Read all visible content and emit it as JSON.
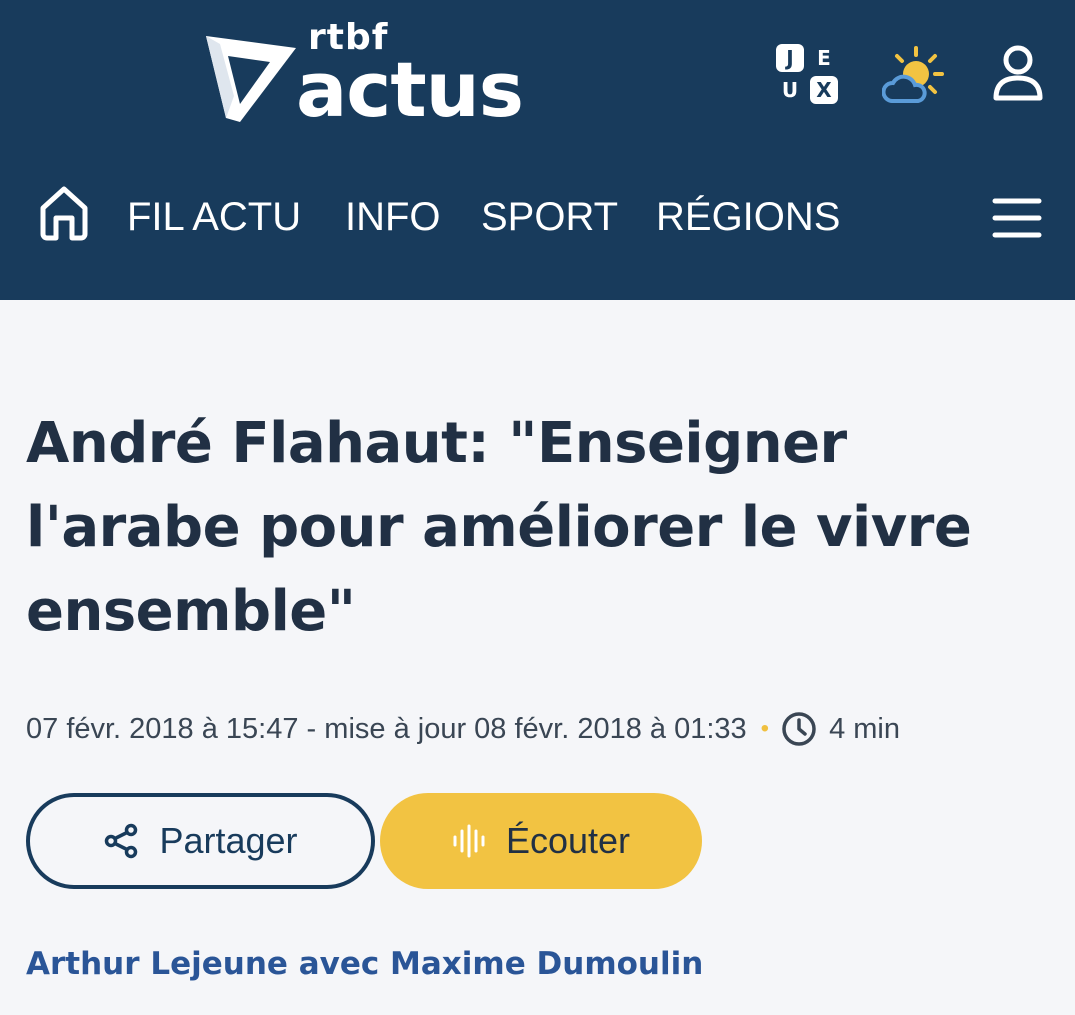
{
  "brand": {
    "rtbf": "rtbf",
    "actus": "actus",
    "color_header": "#183b5c"
  },
  "header": {
    "jeux": {
      "letters": [
        "J",
        "E",
        "U",
        "X"
      ]
    },
    "icons": [
      "jeux-icon",
      "weather-sun-cloud-icon",
      "profile-icon"
    ]
  },
  "nav": {
    "home_icon": "home-icon",
    "items": [
      {
        "label": "FIL ACTU"
      },
      {
        "label": "INFO"
      },
      {
        "label": "SPORT"
      },
      {
        "label": "RÉGIONS"
      }
    ],
    "menu_icon": "hamburger-menu-icon"
  },
  "article": {
    "title": "André Flahaut: \"Enseigner l'arabe pour améliorer le vivre ensemble\"",
    "published": "07 févr. 2018 à 15:47",
    "separator": " - ",
    "updated": "mise à jour 08 févr. 2018 à 01:33",
    "dot": "•",
    "reading_time": "4 min",
    "authors": "Arthur Lejeune avec Maxime Dumoulin"
  },
  "actions": {
    "share_label": "Partager",
    "listen_label": "Écouter"
  },
  "colors": {
    "accent_yellow": "#f2c342",
    "author_link": "#2a5597",
    "title_text": "#213044"
  }
}
